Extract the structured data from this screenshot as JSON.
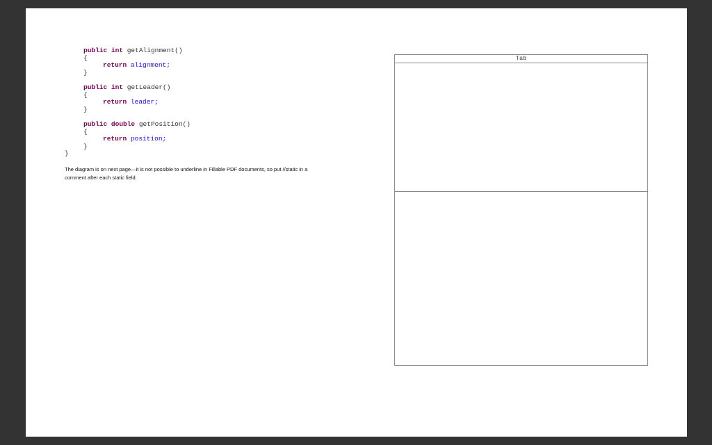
{
  "code": {
    "method1": {
      "keyword": "public",
      "type": "int",
      "name": "getAlignment()",
      "open": "{",
      "return_kw": "return",
      "return_val": "alignment;",
      "close": "}"
    },
    "method2": {
      "keyword": "public",
      "type": "int",
      "name": "getLeader()",
      "open": "{",
      "return_kw": "return",
      "return_val": "leader;",
      "close": "}"
    },
    "method3": {
      "keyword": "public",
      "type": "double",
      "name": "getPosition()",
      "open": "{",
      "return_kw": "return",
      "return_val": "position;",
      "close": "}"
    },
    "class_close": "}"
  },
  "note": "The diagram is on next page—it is not possible to underline in Fillable PDF documents, so put //static in a comment after each static field.",
  "uml": {
    "class_name": "Tab",
    "fields": "",
    "methods": ""
  },
  "colors": {
    "keyword": "#7f0055",
    "field": "#2a00ff",
    "background": "#333333",
    "page": "#ffffff"
  }
}
